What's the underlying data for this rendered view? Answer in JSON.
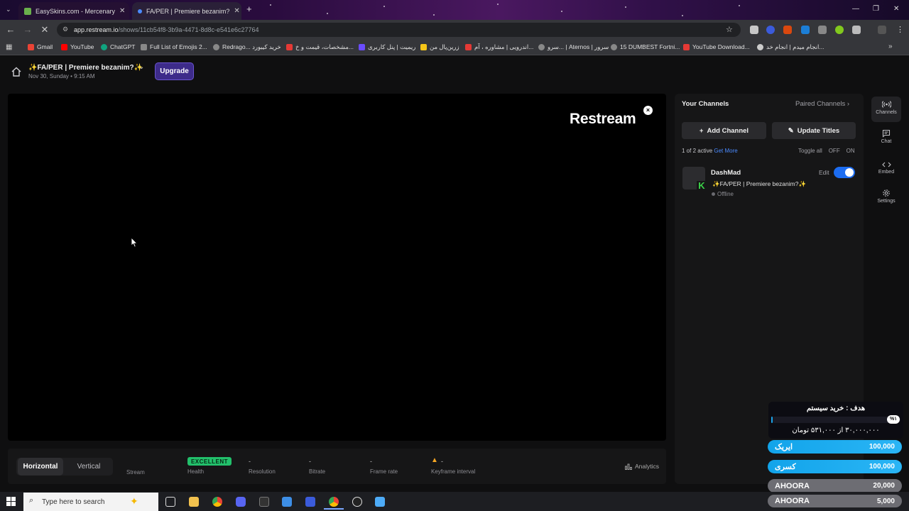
{
  "browser": {
    "tabs": [
      {
        "title": "EasySkins.com - Mercenary",
        "active": false
      },
      {
        "title": "FA/PER | Premiere bezanim?",
        "active": true
      }
    ],
    "new_tab_glyph": "+",
    "window_controls": [
      "—",
      "❐",
      "✕"
    ],
    "url_host": "app.restream.io",
    "url_path": "/shows/11cb54f8-3b9a-4471-8d8c-e541e6c27764",
    "bookmarks": [
      {
        "label": "Gmail",
        "icon": "gmail-icon",
        "color": "#ea4335"
      },
      {
        "label": "YouTube",
        "icon": "youtube-icon",
        "color": "#ff0000"
      },
      {
        "label": "ChatGPT",
        "icon": "chatgpt-icon",
        "color": "#10a37f"
      },
      {
        "label": "Full List of Emojis 2...",
        "icon": "dollar-icon",
        "color": "#888888"
      },
      {
        "label": "Redrago... خرید کیبورد",
        "icon": "globe-icon",
        "color": "#888888"
      },
      {
        "label": "مشخصات، قیمت و خ...",
        "icon": "store-icon",
        "color": "#e53935"
      },
      {
        "label": "ریمیت | پنل کاربری",
        "icon": "remit-icon",
        "color": "#6a4cff"
      },
      {
        "label": "زرین‌پال من",
        "icon": "zarinpal-icon",
        "color": "#f5c518"
      },
      {
        "label": "اندرویی | مشاوره ، آم...",
        "icon": "android-icon",
        "color": "#e53935"
      },
      {
        "label": "سرو... | Aternos | سرور",
        "icon": "globe-icon",
        "color": "#888888"
      },
      {
        "label": "15 DUMBEST Fortni...",
        "icon": "globe-icon",
        "color": "#888888"
      },
      {
        "label": "YouTube Download...",
        "icon": "youtube-download-icon",
        "color": "#e53935"
      },
      {
        "label": "انجام میدم | انجام خد...",
        "icon": "ponisha-icon",
        "color": "#cccccc"
      }
    ]
  },
  "app": {
    "show_title": "✨FA/PER | Premiere bezanim?✨",
    "show_date": "Nov 30, Sunday • 9:15 AM",
    "upgrade_label": "Upgrade",
    "logo_text": "Restream",
    "close_glyph": "×",
    "orientation": {
      "horizontal": "Horizontal",
      "vertical": "Vertical",
      "selected": "Horizontal"
    },
    "stats": [
      {
        "label": "Stream",
        "value": ""
      },
      {
        "label": "Health",
        "value": "EXCELLENT"
      },
      {
        "label": "Resolution",
        "value": "-"
      },
      {
        "label": "Bitrate",
        "value": "-"
      },
      {
        "label": "Frame rate",
        "value": "-"
      },
      {
        "label": "Keyframe interval",
        "value": "-"
      }
    ],
    "analytics_label": "Analytics",
    "colors": {
      "accent": "#1c6cf0",
      "healthy": "#22c06b",
      "upgrade": "#3d2b8a",
      "warning": "#f5a623"
    }
  },
  "channels_panel": {
    "title": "Your Channels",
    "paired_label": "Paired Channels",
    "add_channel": "Add Channel",
    "update_titles": "Update Titles",
    "active_count": "1 of 2 active",
    "get_more": "Get More",
    "toggle_all": "Toggle all",
    "off": "OFF",
    "on": "ON",
    "channel": {
      "name": "DashMad",
      "title": "✨FA/PER | Premiere bezanim?✨",
      "status": "Offline",
      "edit_label": "Edit",
      "enabled": true,
      "platform_icon": "kick-icon",
      "platform_letter": "K"
    }
  },
  "sidenav": [
    {
      "label": "Channels",
      "icon": "broadcast-icon"
    },
    {
      "label": "Chat",
      "icon": "chat-icon"
    },
    {
      "label": "Embed",
      "icon": "code-icon"
    },
    {
      "label": "Settings",
      "icon": "gear-icon"
    }
  ],
  "donation_overlay": {
    "goal": "هدف : خرید سیستم",
    "percent": "%۱",
    "progress": 0.01,
    "amount": "۳۰,۰۰۰,۰۰۰ از ۵۳۱,۰۰۰ تومان",
    "donors": [
      {
        "name": "ایریک",
        "value": "100,000",
        "color": "#1aa3e8"
      },
      {
        "name": "کسری",
        "value": "100,000",
        "color": "#1aa3e8"
      },
      {
        "name": "AHOORA",
        "value": "20,000",
        "color": "#6d6d73"
      },
      {
        "name": "AHOORA",
        "value": "5,000",
        "color": "#6d6d73"
      }
    ]
  },
  "taskbar": {
    "search_placeholder": "Type here to search",
    "apps": [
      "windows-icon",
      "task-view-icon",
      "file-explorer-icon",
      "chrome-icon",
      "discord-icon",
      "cmd-icon",
      "vscode-icon",
      "app-icon",
      "chrome-active-icon",
      "obs-icon",
      "notepad-icon"
    ]
  }
}
